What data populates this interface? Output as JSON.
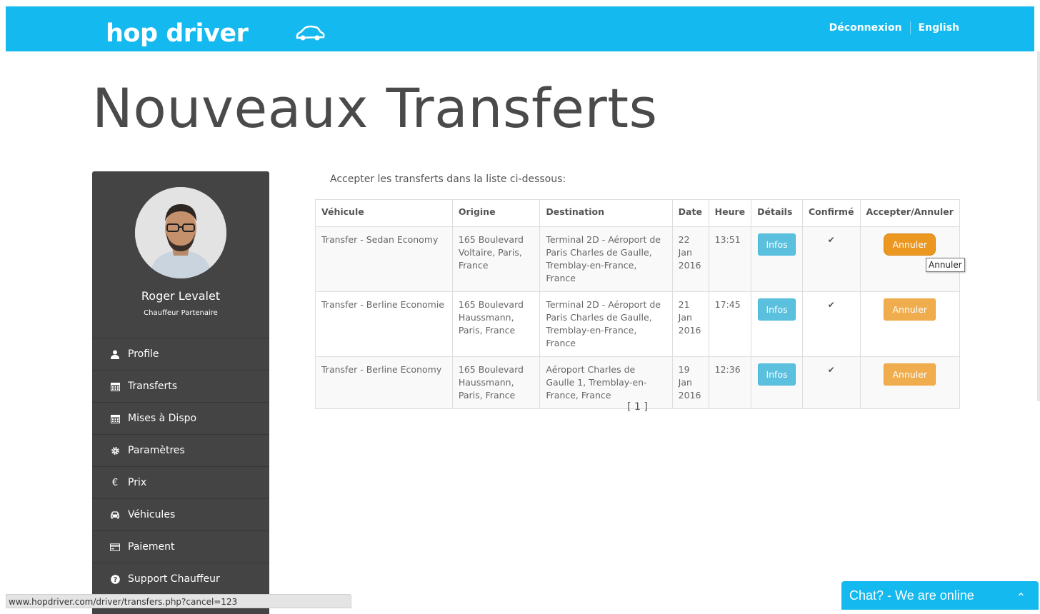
{
  "header": {
    "logo_text": "hop driver",
    "nav": {
      "logout": "Déconnexion",
      "language": "English"
    }
  },
  "page": {
    "title": "Nouveaux Transferts"
  },
  "sidebar": {
    "user_name": "Roger Levalet",
    "user_role": "Chauffeur Partenaire",
    "items": [
      {
        "label": "Profile",
        "icon": "user-icon"
      },
      {
        "label": "Transferts",
        "icon": "calendar-icon"
      },
      {
        "label": "Mises à Dispo",
        "icon": "calendar-icon"
      },
      {
        "label": "Paramètres",
        "icon": "gear-icon"
      },
      {
        "label": "Prix",
        "icon": "euro-icon"
      },
      {
        "label": "Véhicules",
        "icon": "car-icon"
      },
      {
        "label": "Paiement",
        "icon": "credit-card-icon"
      },
      {
        "label": "Support Chauffeur",
        "icon": "question-circle-icon"
      }
    ]
  },
  "main": {
    "intro": "Accepter les transferts dans la liste ci-dessous:",
    "table": {
      "headers": [
        "Véhicule",
        "Origine",
        "Destination",
        "Date",
        "Heure",
        "Détails",
        "Confirmé",
        "Accepter/Annuler"
      ],
      "rows": [
        {
          "vehicle": "Transfer - Sedan Economy",
          "origin": "165 Boulevard Voltaire, Paris, France",
          "destination": "Terminal 2D - Aéroport de Paris Charles de Gaulle, Tremblay-en-France, France",
          "date_day": "22",
          "date_month": "Jan",
          "date_year": "2016",
          "time": "13:51",
          "details_label": "Infos",
          "confirmed": "✔",
          "action_label": "Annuler"
        },
        {
          "vehicle": "Transfer - Berline Economie",
          "origin": "165 Boulevard Haussmann, Paris, France",
          "destination": "Terminal 2D - Aéroport de Paris Charles de Gaulle, Tremblay-en-France, France",
          "date_day": "21",
          "date_month": "Jan",
          "date_year": "2016",
          "time": "17:45",
          "details_label": "Infos",
          "confirmed": "✔",
          "action_label": "Annuler"
        },
        {
          "vehicle": "Transfer - Berline Economy",
          "origin": "165 Boulevard Haussmann, Paris, France",
          "destination": "Aéroport Charles de Gaulle 1, Tremblay-en-France, France",
          "date_day": "19",
          "date_month": "Jan",
          "date_year": "2016",
          "time": "12:36",
          "details_label": "Infos",
          "confirmed": "✔",
          "action_label": "Annuler"
        }
      ]
    },
    "tooltip": "Annuler",
    "pagination": "[ 1 ]"
  },
  "status_bar": {
    "url": "www.hopdriver.com/driver/transfers.php?cancel=123"
  },
  "chat": {
    "label": "Chat? - We are online",
    "chevron": "⌃"
  },
  "colors": {
    "brand": "#13b9ef",
    "sidebar": "#444444",
    "info_button": "#5bc0de",
    "warning_button": "#f0ad4e"
  }
}
